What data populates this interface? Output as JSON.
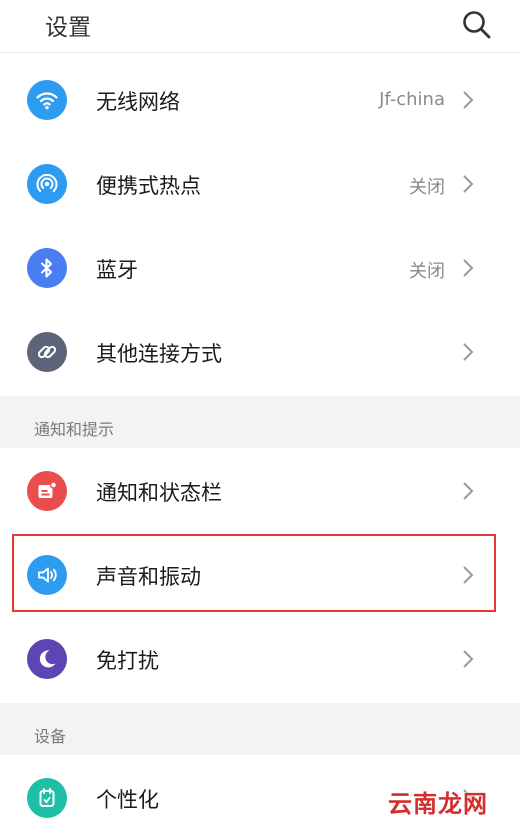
{
  "header": {
    "title": "设置",
    "search_icon": "search-icon"
  },
  "sections": [
    {
      "label": "通知和提示"
    },
    {
      "label": "设备"
    }
  ],
  "items": [
    {
      "label": "无线网络",
      "value": "Jf-china",
      "icon": "wifi-icon",
      "color": "#2d9bf0"
    },
    {
      "label": "便携式热点",
      "value": "关闭",
      "icon": "hotspot-icon",
      "color": "#2d9bf0"
    },
    {
      "label": "蓝牙",
      "value": "关闭",
      "icon": "bluetooth-icon",
      "color": "#4a7cf2"
    },
    {
      "label": "其他连接方式",
      "value": "",
      "icon": "link-icon",
      "color": "#5c6477"
    },
    {
      "label": "通知和状态栏",
      "value": "",
      "icon": "notification-icon",
      "color": "#ea4d4d"
    },
    {
      "label": "声音和振动",
      "value": "",
      "icon": "speaker-icon",
      "color": "#2d9bf0"
    },
    {
      "label": "免打扰",
      "value": "",
      "icon": "moon-icon",
      "color": "#5b46b3"
    },
    {
      "label": "个性化",
      "value": "",
      "icon": "personalize-icon",
      "color": "#1ebfa4"
    }
  ],
  "highlight_color": "#e53935",
  "watermark": "云南龙网"
}
